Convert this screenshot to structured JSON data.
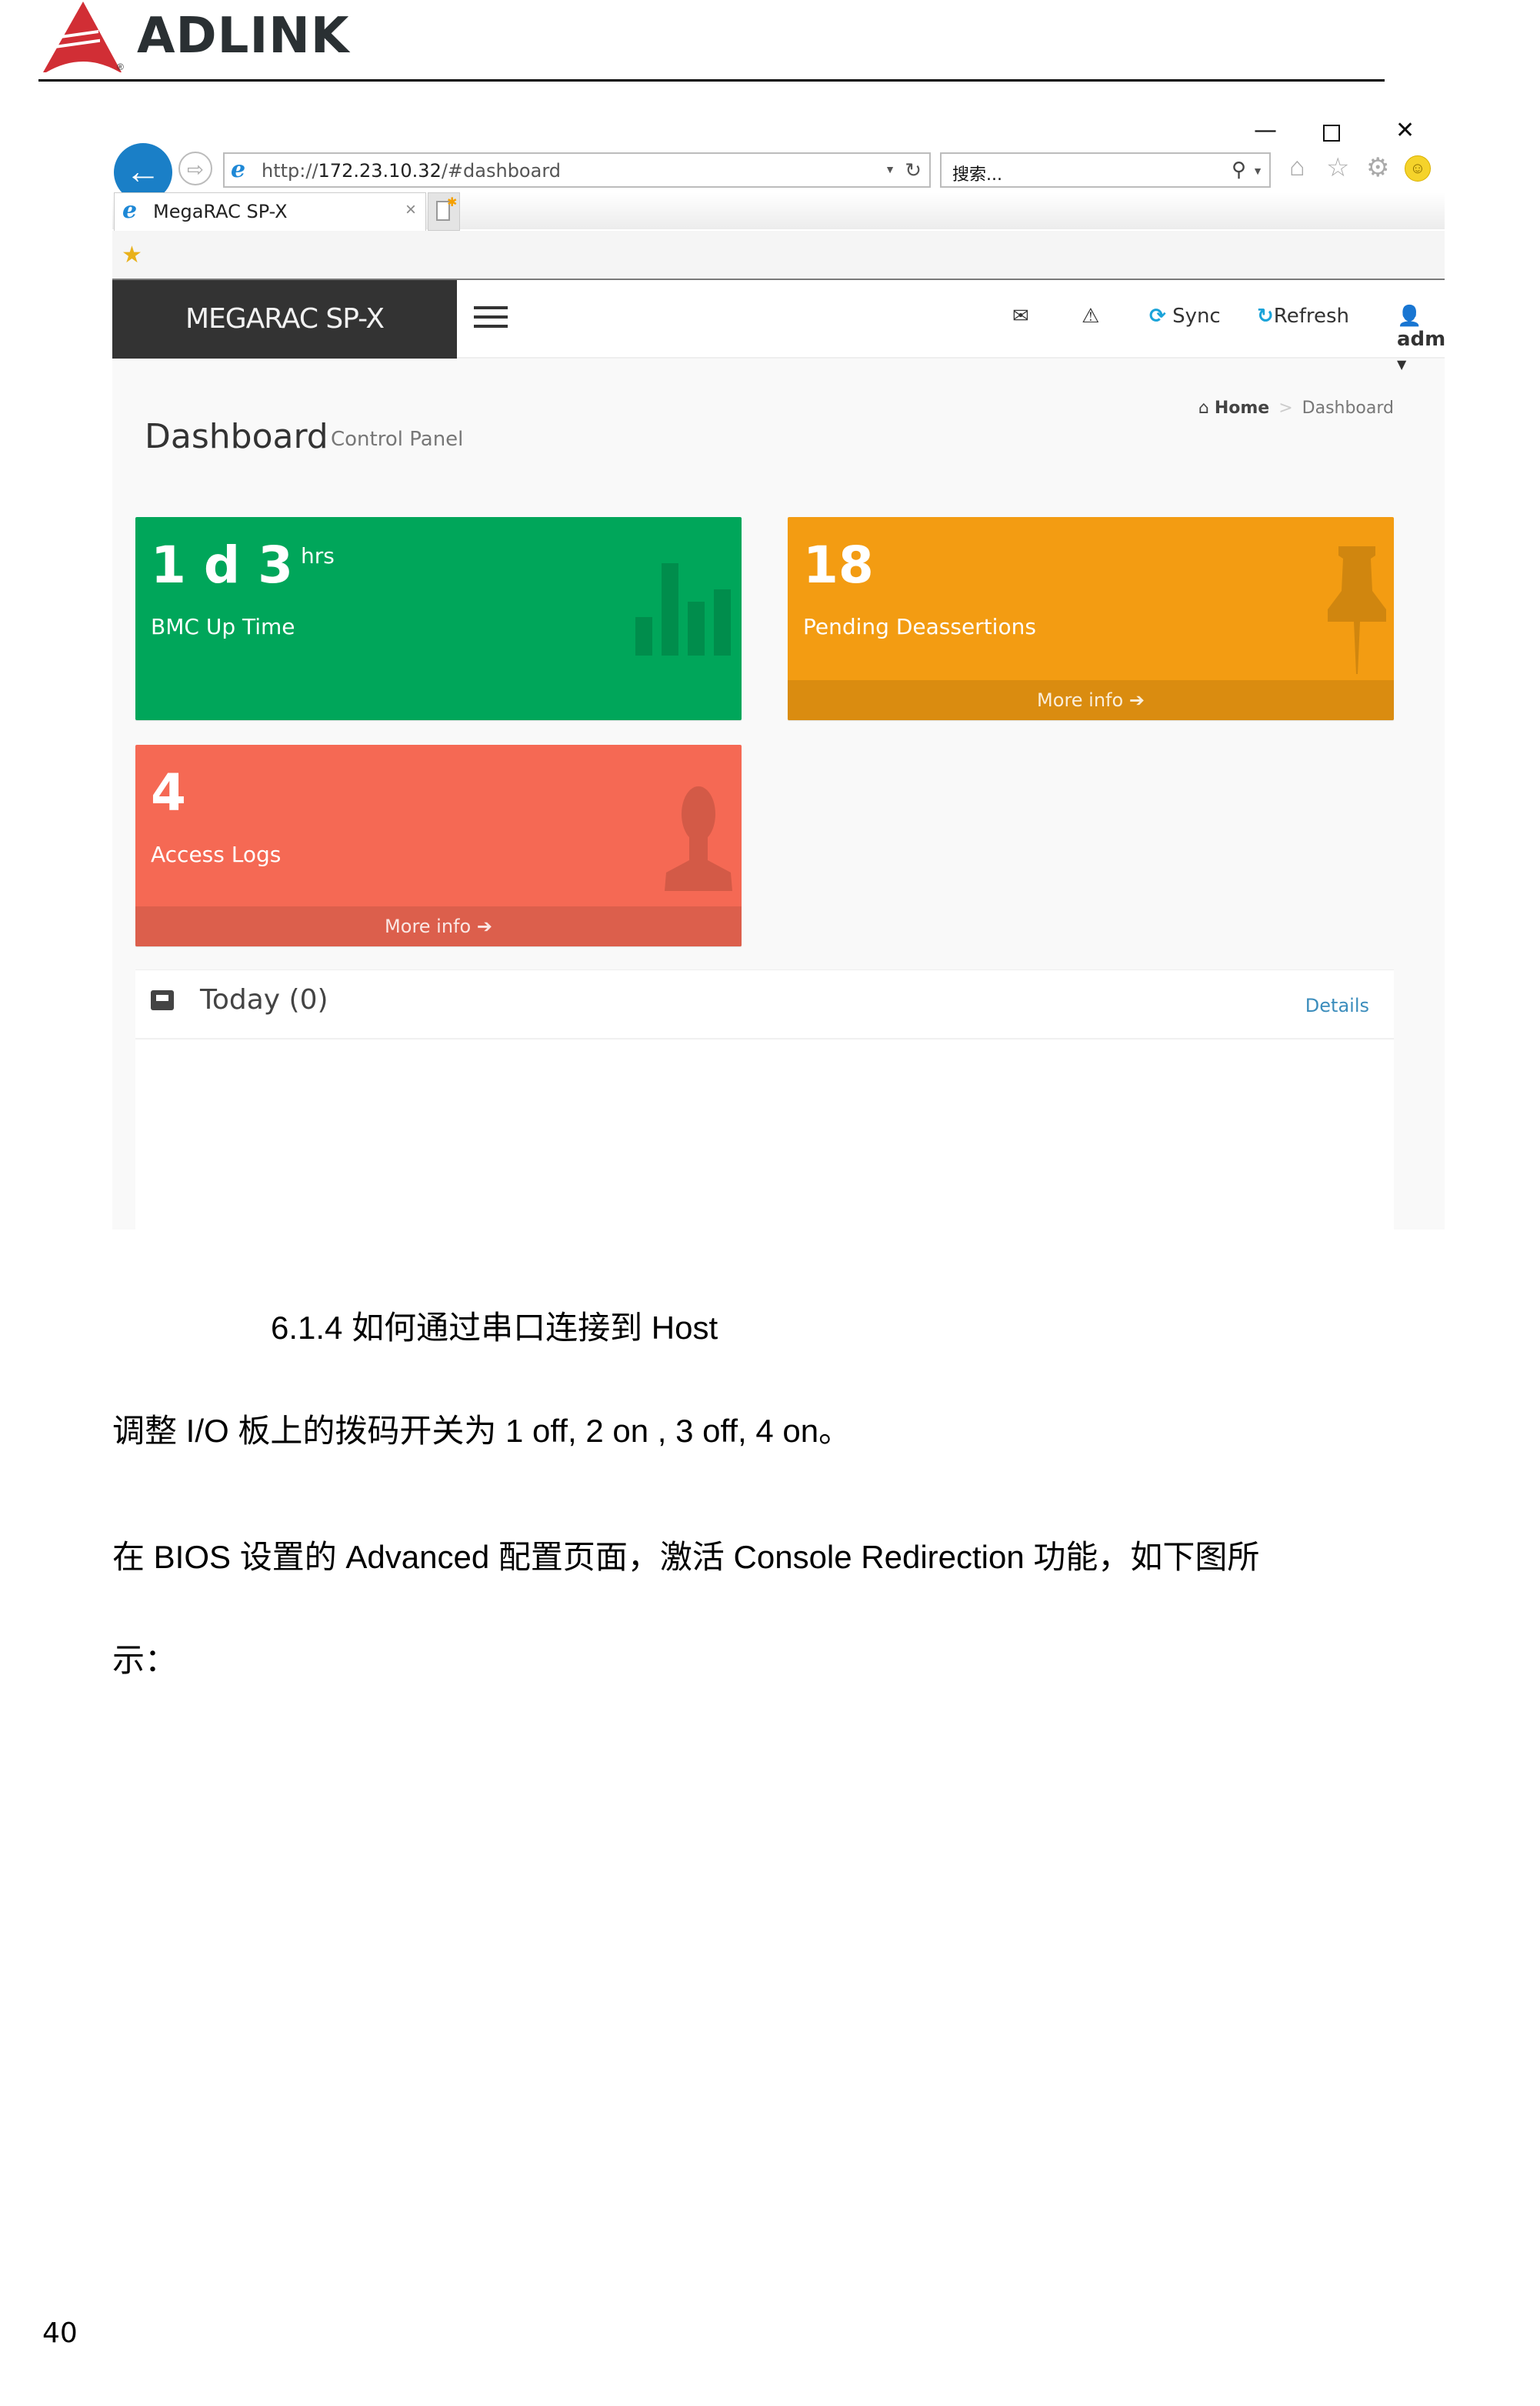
{
  "document": {
    "logo_text": "ADLINK",
    "heading": "6.1.4 如何通过串口连接到 Host",
    "paragraphs": [
      "调整 I/O 板上的拨码开关为 1 off, 2 on , 3 off, 4 on。",
      "在 BIOS 设置的 Advanced 配置页面，激活 Console Redirection 功能，如下图所",
      "示："
    ],
    "page_number": "40"
  },
  "browser": {
    "window_controls": {
      "minimize": "—",
      "maximize": "",
      "close": "✕"
    },
    "address": {
      "prefix": "http://",
      "host": "172.23.10.32",
      "path": "/#dashboard"
    },
    "search_placeholder": "搜索...",
    "tab_title": "MegaRAC SP-X"
  },
  "app": {
    "brand": "MEGARAC SP-X",
    "nav": {
      "sync": "Sync",
      "refresh": "Refresh",
      "user": "admin"
    },
    "page_title": "Dashboard",
    "page_subtitle": "Control Panel",
    "breadcrumb": {
      "home": "Home",
      "current": "Dashboard"
    },
    "info_boxes": [
      {
        "value": "1 d 3",
        "unit": "hrs",
        "label": "BMC Up Time",
        "color": "#00a65a"
      },
      {
        "value": "18",
        "label": "Pending Deassertions",
        "footer": "More info",
        "color": "#f39c12"
      },
      {
        "value": "4",
        "label": "Access Logs",
        "footer": "More info",
        "color": "#f56954"
      }
    ],
    "today_panel": {
      "title": "Today (0)",
      "details": "Details"
    }
  }
}
